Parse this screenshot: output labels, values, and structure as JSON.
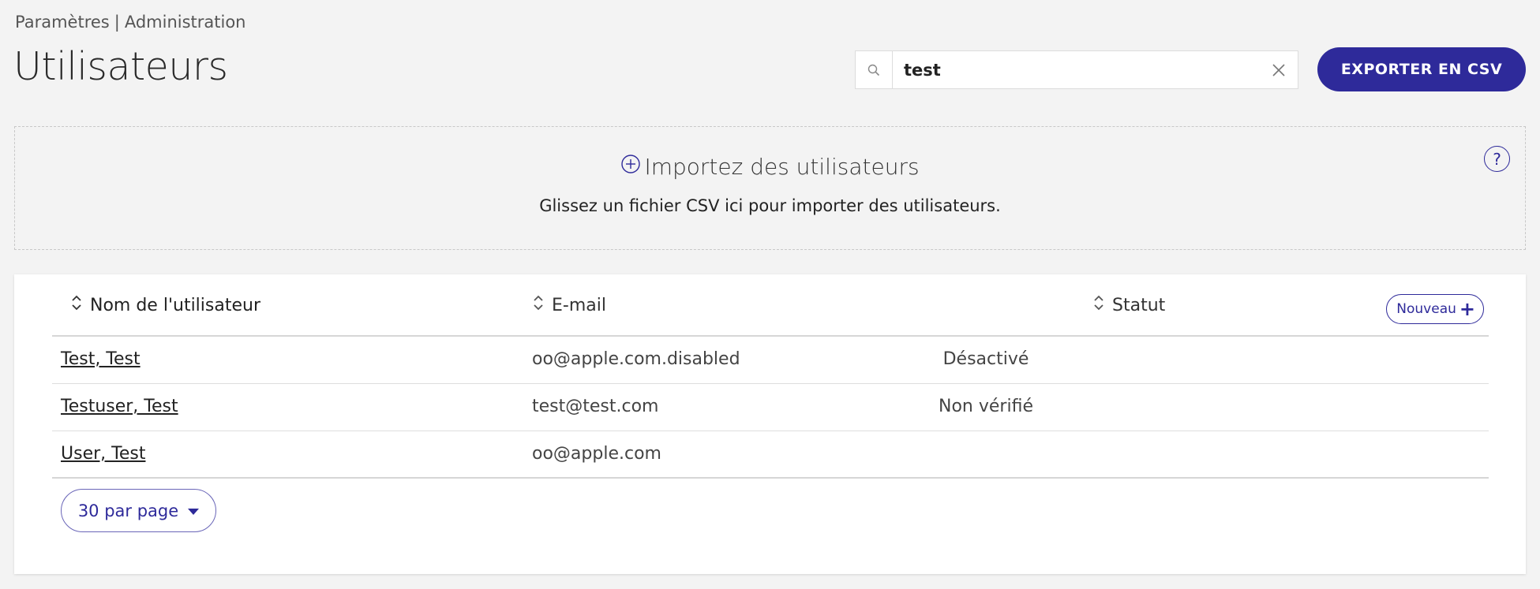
{
  "breadcrumb": {
    "part1": "Paramètres",
    "separator": "|",
    "part2": "Administration"
  },
  "page_title": "Utilisateurs",
  "search": {
    "value": "test",
    "placeholder": ""
  },
  "export_button": "EXPORTER EN CSV",
  "import": {
    "title": "Importez des utilisateurs",
    "text": "Glissez un fichier CSV ici pour importer des utilisateurs.",
    "help": "?"
  },
  "table": {
    "columns": {
      "name": "Nom de l'utilisateur",
      "email": "E-mail",
      "status": "Statut"
    },
    "new_button": "Nouveau",
    "rows": [
      {
        "name": "Test, Test",
        "email": "oo@apple.com.disabled",
        "status": "Désactivé"
      },
      {
        "name": "Testuser, Test",
        "email": "test@test.com",
        "status": "Non vérifié"
      },
      {
        "name": "User, Test",
        "email": "oo@apple.com",
        "status": ""
      }
    ]
  },
  "pagination": {
    "per_page": "30 par page"
  },
  "colors": {
    "accent": "#2e2a9a",
    "background": "#f3f3f3"
  }
}
